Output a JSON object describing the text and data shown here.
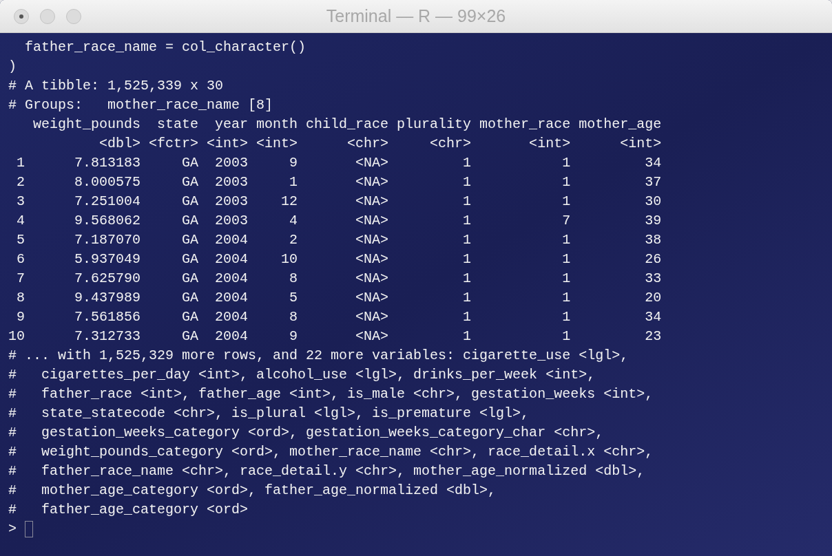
{
  "window": {
    "title": "Terminal — R — 99×26"
  },
  "terminal": {
    "lines": [
      "  father_race_name = col_character()",
      ")",
      "# A tibble: 1,525,339 x 30",
      "# Groups:   mother_race_name [8]",
      "   weight_pounds  state  year month child_race plurality mother_race mother_age",
      "           <dbl> <fctr> <int> <int>      <chr>     <chr>       <int>      <int>",
      " 1      7.813183     GA  2003     9       <NA>         1           1         34",
      " 2      8.000575     GA  2003     1       <NA>         1           1         37",
      " 3      7.251004     GA  2003    12       <NA>         1           1         30",
      " 4      9.568062     GA  2003     4       <NA>         1           7         39",
      " 5      7.187070     GA  2004     2       <NA>         1           1         38",
      " 6      5.937049     GA  2004    10       <NA>         1           1         26",
      " 7      7.625790     GA  2004     8       <NA>         1           1         33",
      " 8      9.437989     GA  2004     5       <NA>         1           1         20",
      " 9      7.561856     GA  2004     8       <NA>         1           1         34",
      "10      7.312733     GA  2004     9       <NA>         1           1         23",
      "# ... with 1,525,329 more rows, and 22 more variables: cigarette_use <lgl>,",
      "#   cigarettes_per_day <int>, alcohol_use <lgl>, drinks_per_week <int>,",
      "#   father_race <int>, father_age <int>, is_male <chr>, gestation_weeks <int>,",
      "#   state_statecode <chr>, is_plural <lgl>, is_premature <lgl>,",
      "#   gestation_weeks_category <ord>, gestation_weeks_category_char <chr>,",
      "#   weight_pounds_category <ord>, mother_race_name <chr>, race_detail.x <chr>,",
      "#   father_race_name <chr>, race_detail.y <chr>, mother_age_normalized <dbl>,",
      "#   mother_age_category <ord>, father_age_normalized <dbl>,",
      "#   father_age_category <ord>"
    ],
    "prompt": ">"
  }
}
